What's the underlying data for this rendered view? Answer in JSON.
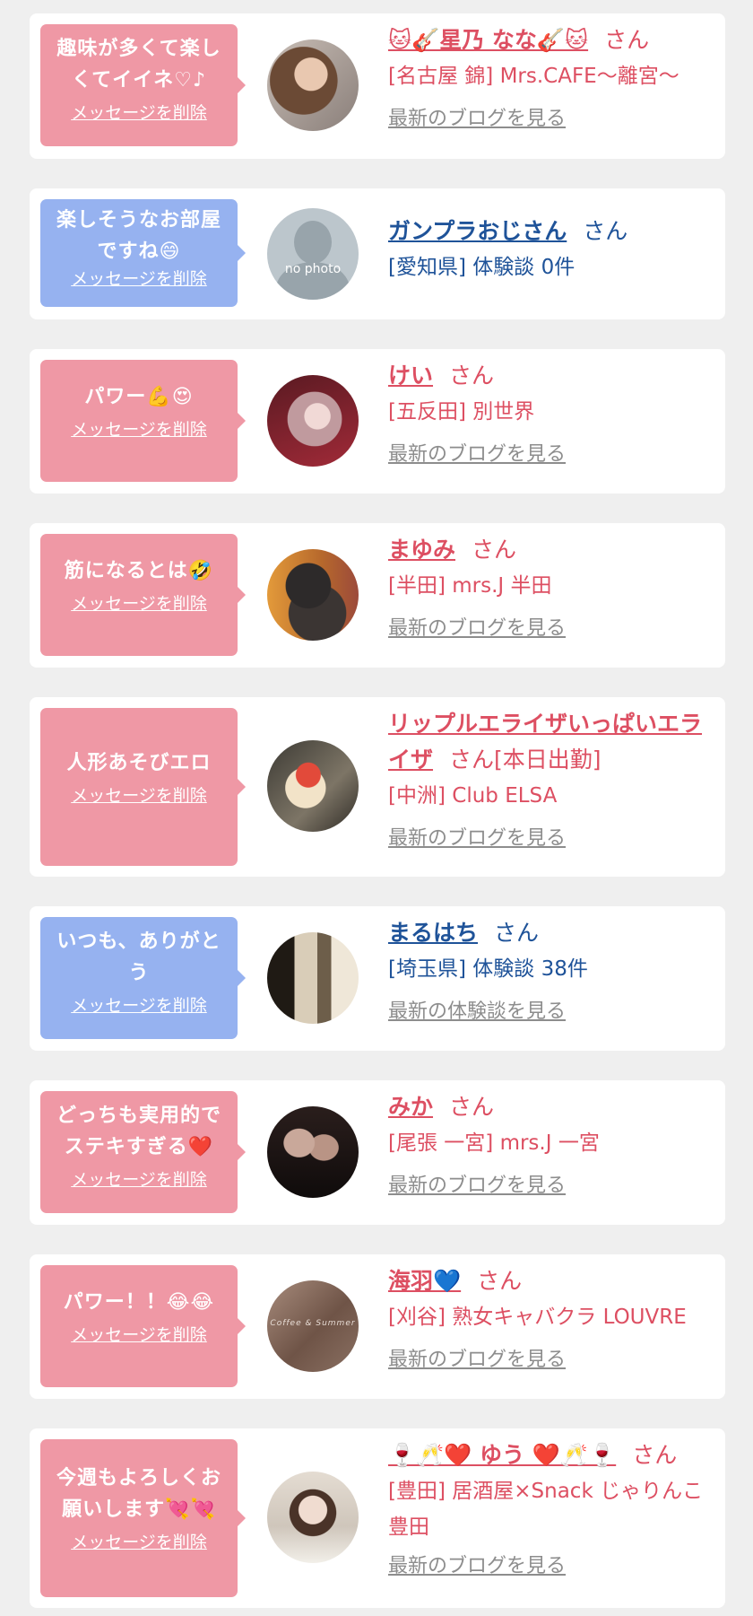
{
  "cards": [
    {
      "color": "pink",
      "message": "趣味が多くて楽しくてイイネ♡♪",
      "delete_label": "メッセージを削除",
      "name": "🐱🎸星乃 なな🎸🐱",
      "suffix": "さん",
      "shop": "[名古屋 錦] Mrs.CAFE〜離宮〜",
      "link": "最新のブログを見る"
    },
    {
      "color": "blue",
      "message": "楽しそうなお部屋ですね😄",
      "delete_label": "メッセージを削除",
      "name": "ガンプラおじさん",
      "suffix": "さん",
      "shop": "[愛知県] 体験談 0件",
      "avatar_text": "no photo",
      "link": ""
    },
    {
      "color": "pink",
      "message": "パワー💪😍",
      "delete_label": "メッセージを削除",
      "name": "けい",
      "suffix": "さん",
      "shop": "[五反田] 別世界",
      "link": "最新のブログを見る"
    },
    {
      "color": "pink",
      "message": "筋になるとは🤣",
      "delete_label": "メッセージを削除",
      "name": "まゆみ",
      "suffix": "さん",
      "shop": "[半田] mrs.J 半田",
      "link": "最新のブログを見る"
    },
    {
      "color": "pink",
      "message": "人形あそびエロ",
      "delete_label": "メッセージを削除",
      "name": "リップルエライザいっぱいエライザ",
      "suffix": "さん[本日出勤]",
      "shop": "[中洲] Club ELSA",
      "link": "最新のブログを見る"
    },
    {
      "color": "blue",
      "message": "いつも、ありがとう",
      "delete_label": "メッセージを削除",
      "name": "まるはち",
      "suffix": "さん",
      "shop": "[埼玉県] 体験談 38件",
      "link": "最新の体験談を見る"
    },
    {
      "color": "pink",
      "message": "どっちも実用的でステキすぎる❤️",
      "delete_label": "メッセージを削除",
      "name": "みか",
      "suffix": "さん",
      "shop": "[尾張 一宮] mrs.J 一宮",
      "link": "最新のブログを見る"
    },
    {
      "color": "pink",
      "message": "パワー！！😂😂",
      "delete_label": "メッセージを削除",
      "name": "海羽💙",
      "suffix": "さん",
      "shop": "[刈谷] 熟女キャバクラ LOUVRE",
      "avatar_text": "Coffee & Summer",
      "link": "最新のブログを見る"
    },
    {
      "color": "pink",
      "message": "今週もよろしくお願いします💘💘",
      "delete_label": "メッセージを削除",
      "name": "🍷🥂❤️ ゆう ❤️🥂🍷",
      "suffix": "さん",
      "shop": "[豊田] 居酒屋×Snack じゃりんこ豊田",
      "link": "最新のブログを見る"
    }
  ]
}
